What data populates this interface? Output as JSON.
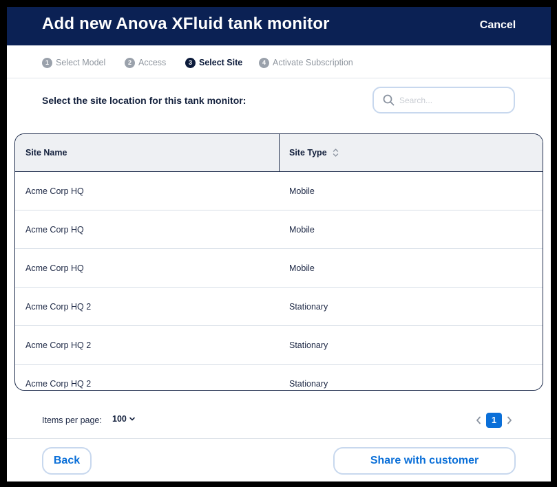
{
  "header": {
    "title": "Add new Anova XFluid tank monitor",
    "cancel_label": "Cancel"
  },
  "steps": [
    {
      "number": "1",
      "label": "Select Model",
      "active": false
    },
    {
      "number": "2",
      "label": "Access",
      "active": false
    },
    {
      "number": "3",
      "label": "Select Site",
      "active": true
    },
    {
      "number": "4",
      "label": "Activate Subscription",
      "active": false
    }
  ],
  "prompt": "Select the site location for this tank monitor:",
  "search": {
    "placeholder": "Search...",
    "icon": "search-icon"
  },
  "table": {
    "columns": [
      "Site Name",
      "Site Type"
    ],
    "rows": [
      {
        "site_name": "Acme Corp HQ",
        "site_type": "Mobile"
      },
      {
        "site_name": "Acme Corp HQ",
        "site_type": "Mobile"
      },
      {
        "site_name": "Acme Corp HQ",
        "site_type": "Mobile"
      },
      {
        "site_name": "Acme Corp HQ 2",
        "site_type": "Stationary"
      },
      {
        "site_name": "Acme Corp HQ 2",
        "site_type": "Stationary"
      },
      {
        "site_name": "Acme Corp HQ 2",
        "site_type": "Stationary"
      }
    ]
  },
  "pagination": {
    "items_per_page_label": "Items per page:",
    "items_per_page_value": "100",
    "current_page": "1"
  },
  "footer": {
    "back_label": "Back",
    "share_label": "Share with customer"
  },
  "colors": {
    "header_bg": "#0b2154",
    "accent": "#0a6fd8",
    "button_border": "#c8d8ee"
  }
}
